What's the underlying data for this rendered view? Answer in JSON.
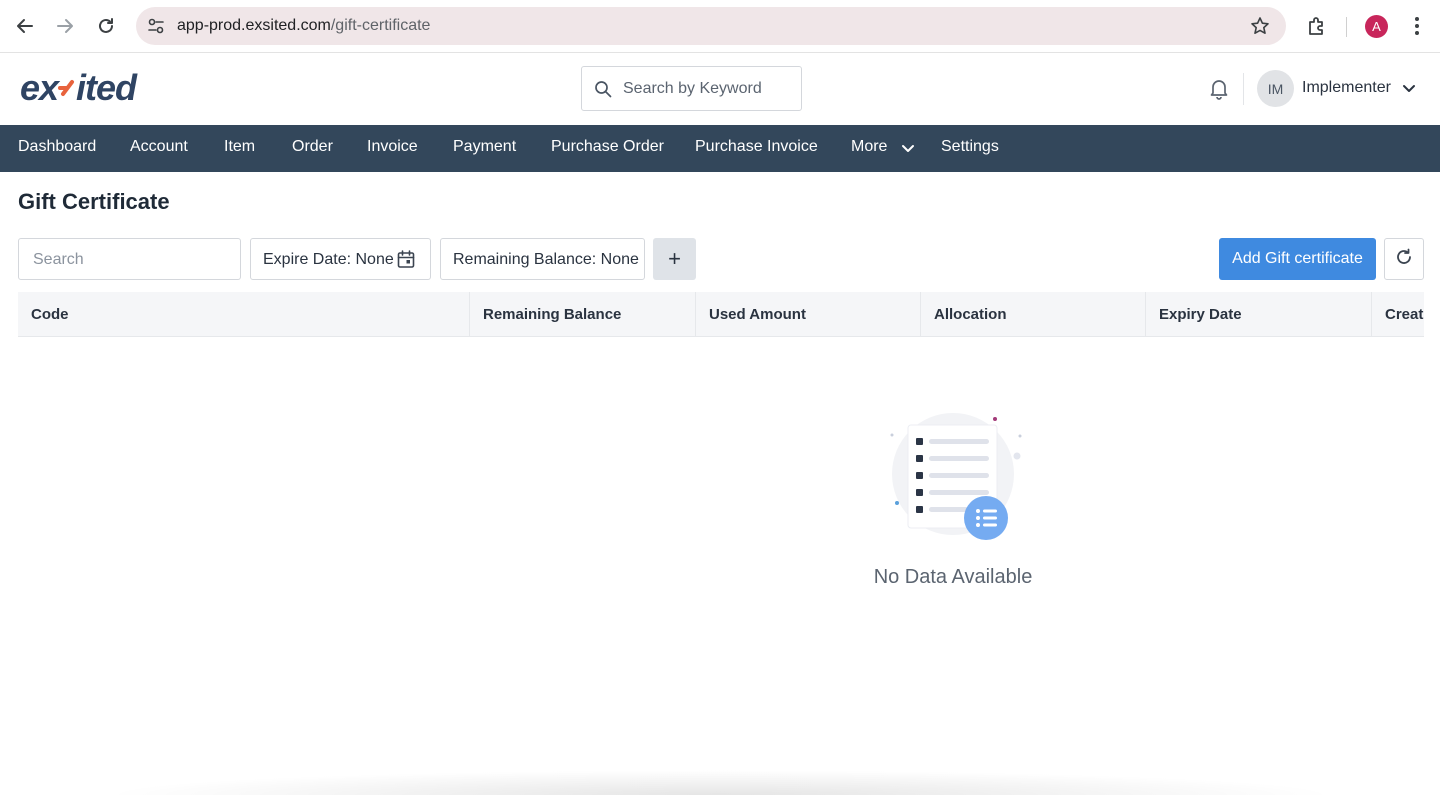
{
  "browser": {
    "url_host": "app-prod.exsited.com",
    "url_path": "/gift-certificate",
    "profile_initial": "A"
  },
  "header": {
    "logo_text": "exsited",
    "search_placeholder": "Search by Keyword",
    "user_initials": "IM",
    "user_name": "Implementer"
  },
  "nav": {
    "items": [
      "Dashboard",
      "Account",
      "Item",
      "Order",
      "Invoice",
      "Payment",
      "Purchase Order",
      "Purchase Invoice",
      "More",
      "Settings"
    ]
  },
  "page": {
    "title": "Gift Certificate",
    "search_placeholder": "Search",
    "filter_expire": "Expire Date: None",
    "filter_balance": "Remaining Balance: None",
    "add_filter_label": "+",
    "add_button": "Add Gift certificate"
  },
  "table": {
    "columns": [
      "Code",
      "Remaining Balance",
      "Used Amount",
      "Allocation",
      "Expiry Date",
      "Create"
    ]
  },
  "empty_state": {
    "message": "No Data Available"
  },
  "colors": {
    "nav_bg": "#33475b",
    "primary": "#3f8ae0",
    "logo_dark": "#2f4463",
    "logo_accent": "#e8633d"
  },
  "icons": [
    "back-arrow-icon",
    "forward-arrow-icon",
    "reload-icon",
    "site-info-icon",
    "star-icon",
    "extensions-icon",
    "kebab-menu-icon",
    "search-icon",
    "bell-icon",
    "chevron-down-icon",
    "calendar-icon",
    "refresh-icon",
    "empty-list-icon"
  ]
}
